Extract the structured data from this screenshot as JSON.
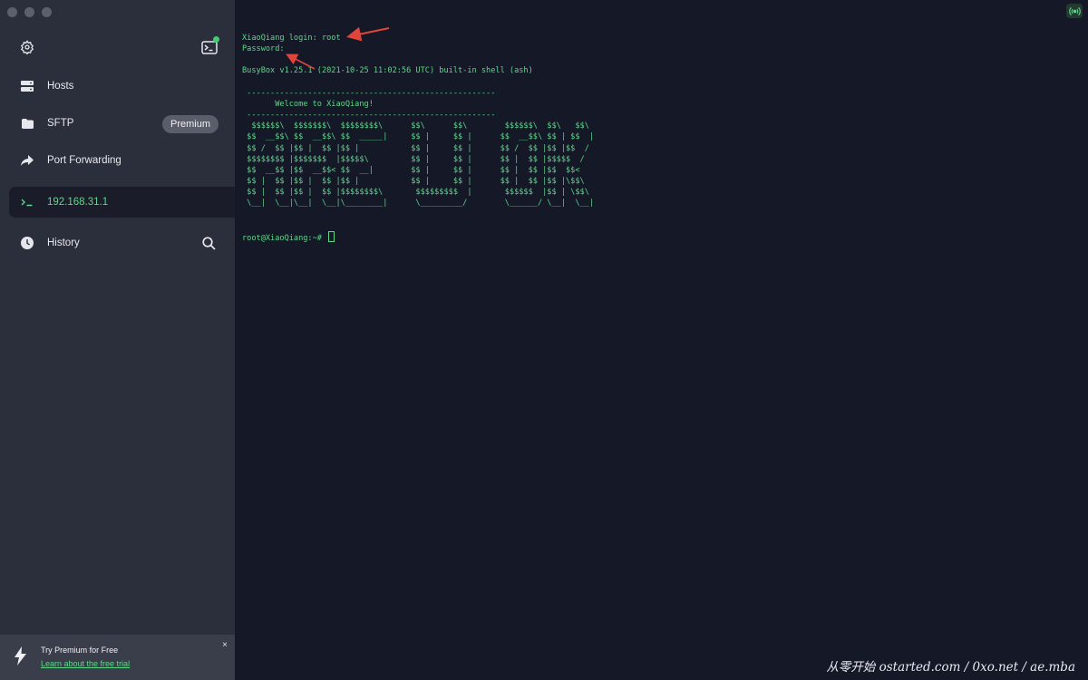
{
  "sidebar": {
    "items": [
      {
        "label": "Hosts",
        "icon": "hosts-icon"
      },
      {
        "label": "SFTP",
        "icon": "folder-icon",
        "badge": "Premium"
      },
      {
        "label": "Port Forwarding",
        "icon": "forward-arrow-icon"
      },
      {
        "label": "192.168.31.1",
        "icon": "terminal-prompt-icon",
        "active": true
      },
      {
        "label": "History",
        "icon": "clock-icon"
      }
    ]
  },
  "promo": {
    "title": "Try Premium for Free",
    "link": "Learn about the free trial",
    "close": "×"
  },
  "terminal": {
    "lines": [
      "XiaoQiang login: root",
      "Password:",
      "",
      "BusyBox v1.25.1 (2021-10-25 11:02:56 UTC) built-in shell (ash)",
      "",
      " -----------------------------------------------------",
      "       Welcome to XiaoQiang!",
      " -----------------------------------------------------",
      "  $$$$$$\\  $$$$$$$\\  $$$$$$$$\\      $$\\      $$\\        $$$$$$\\  $$\\   $$\\",
      " $$  __$$\\ $$  __$$\\ $$  _____|     $$ |     $$ |      $$  __$$\\ $$ | $$  |",
      " $$ /  $$ |$$ |  $$ |$$ |           $$ |     $$ |      $$ /  $$ |$$ |$$  /",
      " $$$$$$$$ |$$$$$$$  |$$$$$\\         $$ |     $$ |      $$ |  $$ |$$$$$  /",
      " $$  __$$ |$$  __$$< $$  __|        $$ |     $$ |      $$ |  $$ |$$  $$<",
      " $$ |  $$ |$$ |  $$ |$$ |           $$ |     $$ |      $$ |  $$ |$$ |\\$$\\",
      " $$ |  $$ |$$ |  $$ |$$$$$$$$\\       $$$$$$$$$  |       $$$$$$  |$$ | \\$$\\",
      " \\__|  \\__|\\__|  \\__|\\________|      \\_________/        \\______/ \\__|  \\__|",
      "",
      ""
    ],
    "prompt": "root@XiaoQiang:~# "
  },
  "colors": {
    "terminal_bg": "#151827",
    "sidebar_bg": "#2b2e3b",
    "accent_green": "#5fd68a",
    "annotation_arrow": "#e0443a"
  },
  "watermark": "从零开始 ostarted.com / 0xo.net / ae.mba"
}
